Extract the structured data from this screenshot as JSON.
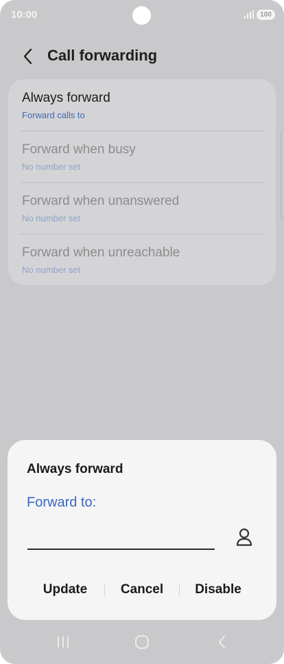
{
  "status_bar": {
    "time": "10:00",
    "battery": "100"
  },
  "header": {
    "title": "Call forwarding"
  },
  "list": {
    "items": [
      {
        "title": "Always forward",
        "subtitle": "Forward calls to"
      },
      {
        "title": "Forward when busy",
        "subtitle": "No number set"
      },
      {
        "title": "Forward when unanswered",
        "subtitle": "No number set"
      },
      {
        "title": "Forward when unreachable",
        "subtitle": "No number set"
      }
    ]
  },
  "dialog": {
    "title": "Always forward",
    "field_label": "Forward to:",
    "input_value": "",
    "buttons": {
      "update": "Update",
      "cancel": "Cancel",
      "disable": "Disable"
    }
  },
  "icons": {
    "back": "chevron-left-icon",
    "contact": "person-icon",
    "recents": "recents-icon",
    "home": "home-icon",
    "back_nav": "back-nav-icon"
  },
  "colors": {
    "accent": "#3a66c0",
    "dim_overlay": "#c9c9cb",
    "dialog_bg": "#f5f5f5"
  }
}
